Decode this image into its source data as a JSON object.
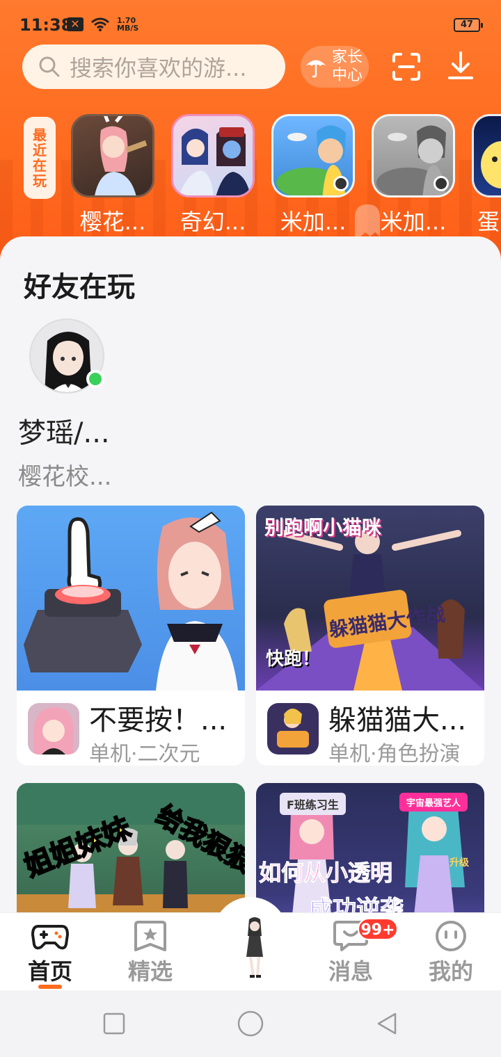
{
  "status_bar": {
    "time": "11:38",
    "speed_value": "1.70",
    "speed_unit": "MB/S",
    "battery": "47"
  },
  "search": {
    "placeholder": "搜索你喜欢的游..."
  },
  "header_actions": {
    "parent_center_line1": "家长",
    "parent_center_line2": "中心"
  },
  "recent": {
    "tag_chars": [
      "最",
      "近",
      "在",
      "玩"
    ],
    "items": [
      {
        "label": "樱花..."
      },
      {
        "label": "奇幻..."
      },
      {
        "label": "米加..."
      },
      {
        "label": "米加..."
      },
      {
        "label": "蛋"
      }
    ]
  },
  "friends_section": {
    "title": "好友在玩",
    "friend": {
      "name": "梦瑶/...",
      "game": "樱花校..."
    }
  },
  "cards": [
    {
      "title": "不要按！...",
      "tags": "单机·二次元",
      "overlay": ""
    },
    {
      "title": "躲猫猫大...",
      "tags": "单机·角色扮演",
      "overlay_top": "别跑啊小猫咪",
      "overlay_logo": "躲猫猫大作战",
      "overlay_run": "快跑！"
    },
    {
      "overlay_left": "姐姐妹妹",
      "overlay_right": "给我狠狠"
    },
    {
      "overlay_badge": "F班练习生",
      "overlay_pink": "宇宙最强艺人",
      "overlay_text": "如何从小透明",
      "overlay_text2": "成功逆袭",
      "overlay_lvl": "升级"
    }
  ],
  "bottom_nav": {
    "home": "首页",
    "featured": "精选",
    "messages": "消息",
    "messages_badge": "99+",
    "mine": "我的"
  },
  "colors": {
    "brand_orange": "#ff6a1e",
    "badge_red": "#ff3b30",
    "online_green": "#3ad15a"
  }
}
